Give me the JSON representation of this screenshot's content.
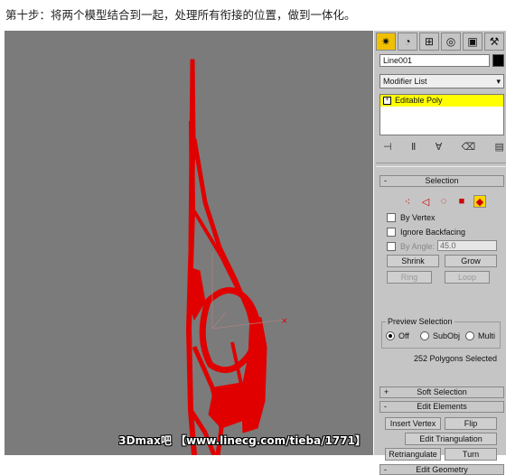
{
  "caption": "第十步：将两个模型结合到一起，处理所有衔接的位置，做到一体化。",
  "watermark": "3Dmax吧 【www.linecg.com/tieba/1771】",
  "panel": {
    "tabs": [
      "create-icon",
      "modify-icon",
      "hierarchy-icon",
      "motion-icon",
      "display-icon",
      "utilities-icon"
    ],
    "object_name": "Line001",
    "object_color": "#000000",
    "modifier_list": "Modifier List",
    "stack_item": "Editable Poly",
    "selection": {
      "title": "Selection",
      "by_vertex": "By Vertex",
      "ignore_backfacing": "Ignore Backfacing",
      "by_angle": "By Angle:",
      "angle_value": "45.0",
      "shrink": "Shrink",
      "grow": "Grow",
      "ring": "Ring",
      "loop": "Loop",
      "preview_title": "Preview Selection",
      "preview_off": "Off",
      "preview_subobj": "SubObj",
      "preview_multi": "Multi",
      "status": "252 Polygons Selected"
    },
    "soft_selection": "Soft Selection",
    "edit_elements": {
      "title": "Edit Elements",
      "insert_vertex": "Insert Vertex",
      "flip": "Flip",
      "edit_triangulation": "Edit Triangulation",
      "retriangulate": "Retriangulate",
      "turn": "Turn"
    },
    "edit_geometry": "Edit Geometry"
  },
  "colors": {
    "viewport": "#7b7b7b",
    "model": "#e00000",
    "panel": "#c5c5c5",
    "highlight": "#ffff00"
  }
}
